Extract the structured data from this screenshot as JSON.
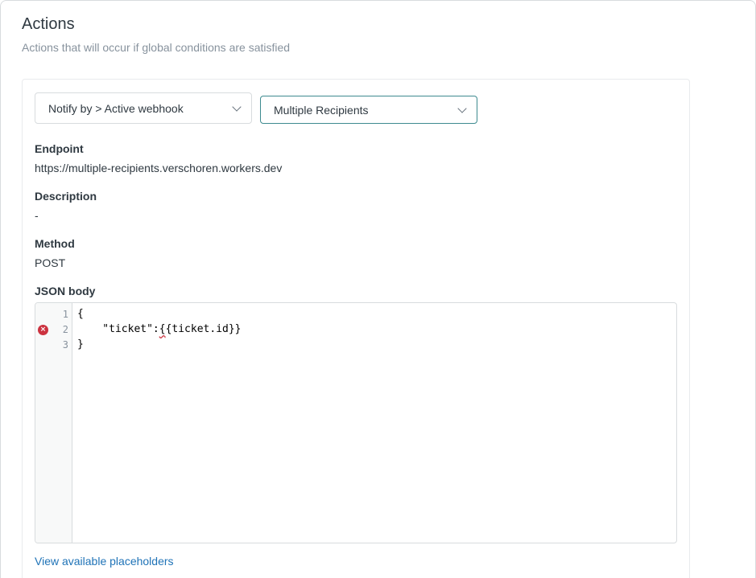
{
  "section": {
    "title": "Actions",
    "subtitle": "Actions that will occur if global conditions are satisfied"
  },
  "action": {
    "notify_select_value": "Notify by > Active webhook",
    "webhook_select_value": "Multiple Recipients"
  },
  "fields": {
    "endpoint_label": "Endpoint",
    "endpoint_value": "https://multiple-recipients.verschoren.workers.dev",
    "description_label": "Description",
    "description_value": "-",
    "method_label": "Method",
    "method_value": "POST",
    "json_label": "JSON body"
  },
  "editor": {
    "lines": [
      {
        "num": "1",
        "text": "{"
      },
      {
        "num": "2",
        "text_before": "    \"ticket\":",
        "text_error": "{",
        "text_after": "{ticket.id}}",
        "has_error": true
      },
      {
        "num": "3",
        "text": "}"
      }
    ],
    "error_icon_glyph": "×"
  },
  "footer": {
    "placeholders_link": "View available placeholders"
  },
  "colors": {
    "accent_link": "#1f73b7",
    "focused_border": "#3d8a8f",
    "error": "#cc3340"
  }
}
